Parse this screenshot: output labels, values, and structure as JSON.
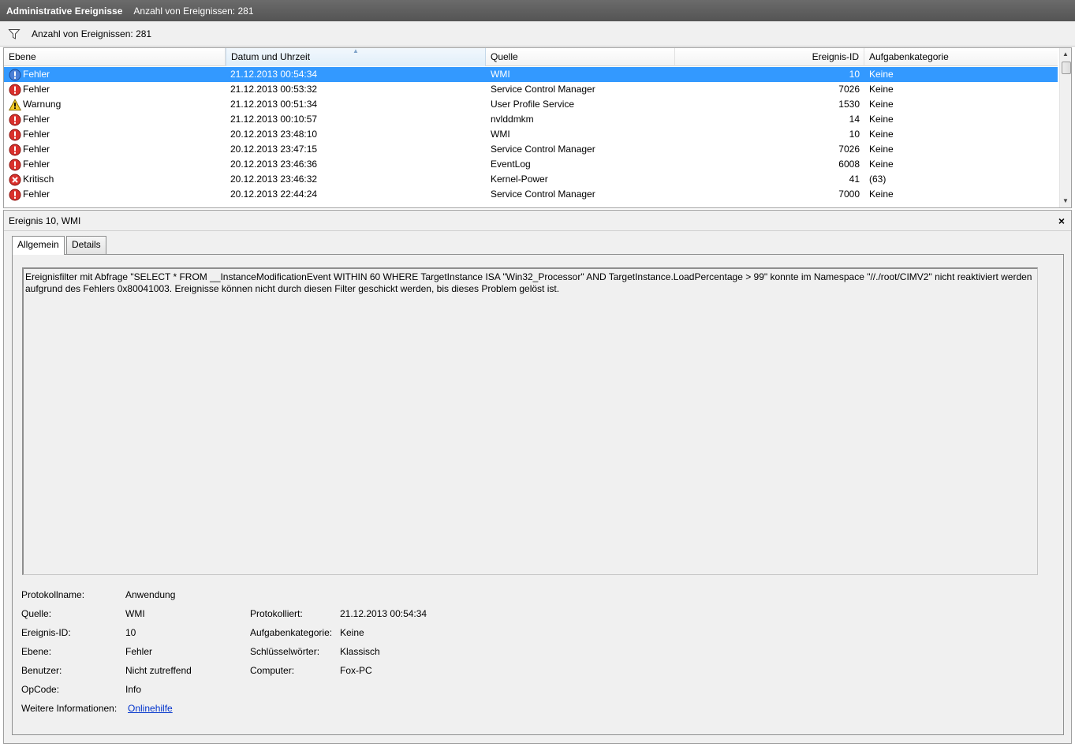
{
  "titlebar": {
    "title": "Administrative Ereignisse",
    "count": "Anzahl von Ereignissen: 281"
  },
  "filter": {
    "count": "Anzahl von Ereignissen: 281",
    "icon": "filter-icon"
  },
  "list": {
    "columns": {
      "level": "Ebene",
      "date": "Datum und Uhrzeit",
      "source": "Quelle",
      "id": "Ereignis-ID",
      "category": "Aufgabenkategorie"
    },
    "rows": [
      {
        "type": "error",
        "level": "Fehler",
        "date": "21.12.2013 00:54:34",
        "source": "WMI",
        "id": "10",
        "category": "Keine",
        "selected": true
      },
      {
        "type": "error",
        "level": "Fehler",
        "date": "21.12.2013 00:53:32",
        "source": "Service Control Manager",
        "id": "7026",
        "category": "Keine"
      },
      {
        "type": "warning",
        "level": "Warnung",
        "date": "21.12.2013 00:51:34",
        "source": "User Profile Service",
        "id": "1530",
        "category": "Keine"
      },
      {
        "type": "error",
        "level": "Fehler",
        "date": "21.12.2013 00:10:57",
        "source": "nvlddmkm",
        "id": "14",
        "category": "Keine"
      },
      {
        "type": "error",
        "level": "Fehler",
        "date": "20.12.2013 23:48:10",
        "source": "WMI",
        "id": "10",
        "category": "Keine"
      },
      {
        "type": "error",
        "level": "Fehler",
        "date": "20.12.2013 23:47:15",
        "source": "Service Control Manager",
        "id": "7026",
        "category": "Keine"
      },
      {
        "type": "error",
        "level": "Fehler",
        "date": "20.12.2013 23:46:36",
        "source": "EventLog",
        "id": "6008",
        "category": "Keine"
      },
      {
        "type": "critical",
        "level": "Kritisch",
        "date": "20.12.2013 23:46:32",
        "source": "Kernel-Power",
        "id": "41",
        "category": "(63)"
      },
      {
        "type": "error",
        "level": "Fehler",
        "date": "20.12.2013 22:44:24",
        "source": "Service Control Manager",
        "id": "7000",
        "category": "Keine"
      }
    ]
  },
  "detail": {
    "title": "Ereignis 10, WMI",
    "close": "×",
    "tabs": {
      "general": "Allgemein",
      "details": "Details"
    },
    "message": "Ereignisfilter mit Abfrage \"SELECT * FROM __InstanceModificationEvent WITHIN 60 WHERE TargetInstance ISA \"Win32_Processor\" AND TargetInstance.LoadPercentage > 99\" konnte im Namespace \"//./root/CIMV2\" nicht reaktiviert werden aufgrund des Fehlers 0x80041003. Ereignisse können nicht durch diesen Filter geschickt werden, bis dieses Problem gelöst ist.",
    "props": {
      "log_label": "Protokollname:",
      "log_value": "Anwendung",
      "source_label": "Quelle:",
      "source_value": "WMI",
      "logged_label": "Protokolliert:",
      "logged_value": "21.12.2013 00:54:34",
      "id_label": "Ereignis-ID:",
      "id_value": "10",
      "category_label": "Aufgabenkategorie:",
      "category_value": "Keine",
      "level_label": "Ebene:",
      "level_value": "Fehler",
      "keywords_label": "Schlüsselwörter:",
      "keywords_value": "Klassisch",
      "user_label": "Benutzer:",
      "user_value": "Nicht zutreffend",
      "computer_label": "Computer:",
      "computer_value": "Fox-PC",
      "opcode_label": "OpCode:",
      "opcode_value": "Info",
      "more_label": "Weitere Informationen:",
      "more_link": "Onlinehilfe"
    }
  }
}
